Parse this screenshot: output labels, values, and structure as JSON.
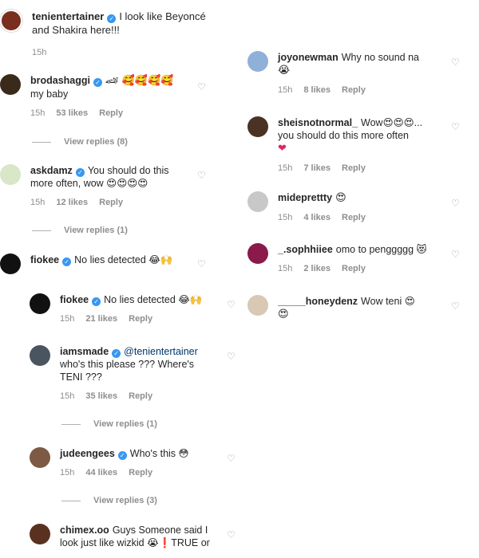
{
  "left": {
    "caption": {
      "username": "tenientertainer",
      "verified": true,
      "text": "I look like Beyoncé and Shakira here!!!",
      "time": "15h",
      "avatar_color": "#7a2e1e"
    },
    "comments": [
      {
        "username": "brodashaggi",
        "verified": true,
        "text_line1": "🏎 🥰🥰🥰🥰",
        "text_line2": "my baby",
        "time": "15h",
        "likes": "53 likes",
        "reply": "Reply",
        "view_replies": "View replies (8)",
        "avatar_color": "#3a2a1a"
      },
      {
        "username": "askdamz",
        "verified": true,
        "text": "You should do this more often, wow 😍😍😍😍",
        "time": "15h",
        "likes": "12 likes",
        "reply": "Reply",
        "view_replies": "View replies (1)",
        "avatar_color": "#d9e6c8"
      },
      {
        "username": "fiokee",
        "verified": true,
        "text": "No lies detected 😂🙌",
        "avatar_color": "#111111"
      }
    ],
    "replies": [
      {
        "username": "fiokee",
        "verified": true,
        "text": "No lies detected 😂🙌",
        "time": "15h",
        "likes": "21 likes",
        "reply": "Reply",
        "avatar_color": "#111111"
      },
      {
        "username": "iamsmade",
        "verified": true,
        "mention": "@tenientertainer",
        "text": "who's this please ??? Where's TENI ???",
        "time": "15h",
        "likes": "35 likes",
        "reply": "Reply",
        "view_replies": "View replies (1)",
        "avatar_color": "#4a5560"
      },
      {
        "username": "judeengees",
        "verified": true,
        "text": "Who's this 😳",
        "time": "15h",
        "likes": "44 likes",
        "reply": "Reply",
        "view_replies": "View replies (3)",
        "avatar_color": "#7c5a44"
      },
      {
        "username": "chimex.oo",
        "verified": false,
        "text": "Guys Someone said I look just like wizkid 😭❗TRUE or",
        "avatar_color": "#5a3020"
      }
    ]
  },
  "right": {
    "comments": [
      {
        "username": "joyonewman",
        "text_line1": "Why no sound na",
        "text_line2": "😭",
        "time": "15h",
        "likes": "8 likes",
        "reply": "Reply",
        "avatar_color": "#8fb0d8"
      },
      {
        "username": "sheisnotnormal_",
        "text_line1": "Wow😍😍😍...",
        "text_line2": "you should do this more often",
        "text_line3": "❤",
        "time": "15h",
        "likes": "7 likes",
        "reply": "Reply",
        "avatar_color": "#4a3224"
      },
      {
        "username": "mideprettty",
        "text": "😍",
        "time": "15h",
        "likes": "4 likes",
        "reply": "Reply",
        "avatar_color": "#c8c8c8"
      },
      {
        "username": "_.sophhiiee",
        "text": "omo to penggggg 😻",
        "time": "15h",
        "likes": "2 likes",
        "reply": "Reply",
        "avatar_color": "#8a1a4a"
      },
      {
        "username": "_____honeydenz",
        "text_line1": "Wow teni 😍",
        "text_line2": "😍",
        "avatar_color": "#d8c8b4"
      }
    ]
  },
  "heart_icon": "♡"
}
